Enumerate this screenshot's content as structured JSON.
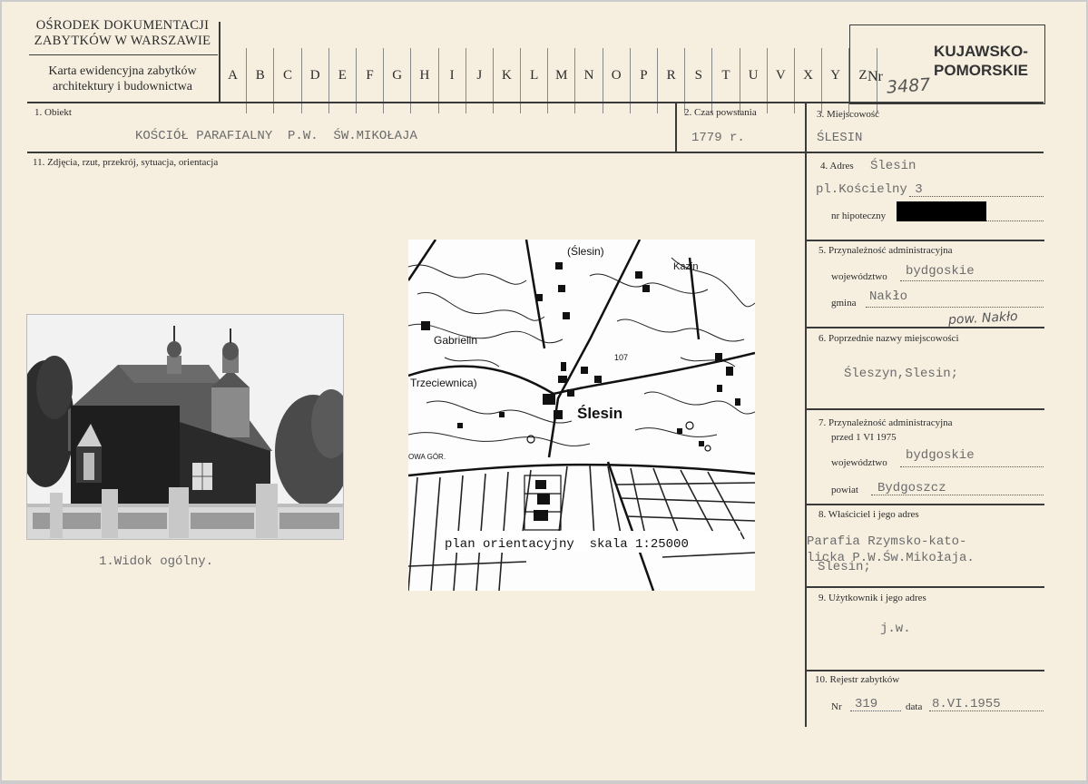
{
  "header": {
    "institution_line1": "OŚRODEK DOKUMENTACJI",
    "institution_line2": "ZABYTKÓW W WARSZAWIE",
    "card_title_line1": "Karta ewidencyjna zabytków",
    "card_title_line2": "architektury i budownictwa",
    "letters": [
      "A",
      "B",
      "C",
      "D",
      "E",
      "F",
      "G",
      "H",
      "I",
      "J",
      "K",
      "L",
      "M",
      "N",
      "O",
      "P",
      "R",
      "S",
      "T",
      "U",
      "V",
      "X",
      "Y",
      "Z"
    ],
    "nr_label": "Nr",
    "nr_value": "3487",
    "region_line1": "KUJAWSKO-",
    "region_line2": "POMORSKIE"
  },
  "fields": {
    "obiekt_label": "1. Obiekt",
    "obiekt_value": "KOŚCIÓŁ PARAFIALNY  P.W.  ŚW.MIKOŁAJA",
    "czas_label": "2. Czas powstania",
    "czas_value": "1779 r.",
    "miejscowosc_label": "3. Miejscowość",
    "miejscowosc_value": "ŚLESIN",
    "zdjecia_label": "11. Zdjęcia, rzut, przekrój, sytuacja, orientacja",
    "adres_label": "4. Adres",
    "adres_value1": "Ślesin",
    "adres_value2": "pl.Kościelny 3",
    "hipoteczny_label": "nr hipoteczny",
    "adm_label": "5. Przynależność administracyjna",
    "wojewodztwo_label": "województwo",
    "wojewodztwo_value": "bydgoskie",
    "gmina_label": "gmina",
    "gmina_value": "Nakło",
    "pow_note": "pow. Nakło",
    "poprzednie_label": "6. Poprzednie nazwy miejscowości",
    "poprzednie_value": "Śleszyn,Slesin;",
    "adm1975_label_line1": "7. Przynależność administracyjna",
    "adm1975_label_line2": "przed 1 VI 1975",
    "wojewodztwo2_label": "województwo",
    "wojewodztwo2_value": "bydgoskie",
    "powiat_label": "powiat",
    "powiat_value": "Bydgoszcz",
    "wlasciciel_label": "8. Właściciel i jego adres",
    "wlasciciel_line1": "Parafia Rzymsko-kato-",
    "wlasciciel_line2": "licka P.W.Św.Mikołaja.",
    "wlasciciel_line3": "Ślesin;",
    "uzytkownik_label": "9. Użytkownik i jego adres",
    "uzytkownik_value": "j.w.",
    "rejestr_label": "10. Rejestr zabytków",
    "rejestr_nr_label": "Nr",
    "rejestr_nr_value": "319",
    "rejestr_data_label": "data",
    "rejestr_data_value": "8.VI.1955"
  },
  "photo": {
    "caption": "1.Widok ogólny."
  },
  "map": {
    "label_slesin_top": "(Ślesin)",
    "label_kazin": "Kazin",
    "label_gabrielin": "Gabrielin",
    "label_trzeciewnica": "Trzeciewnica)",
    "label_slesin": "Ślesin",
    "label_107": "107",
    "label_nowa_gora": "OWA GÓR.",
    "caption": "plan orientacyjny  skala 1:25000"
  }
}
